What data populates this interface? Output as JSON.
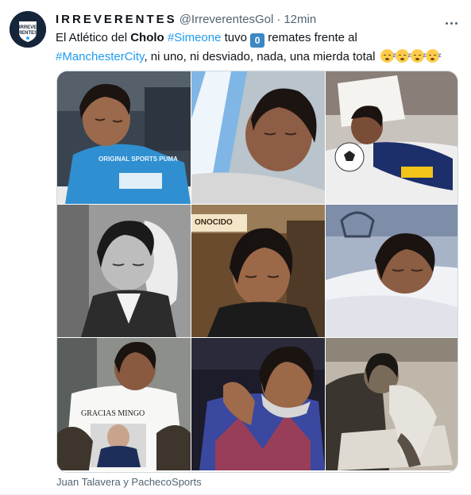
{
  "tweet": {
    "display_name": "IRREVERENTES",
    "handle": "@IrreverentesGol",
    "separator": "·",
    "time": "12min",
    "avatar_text": "IRREVE RENTES",
    "text": {
      "p1": "El Atlético del ",
      "bold1": "Cholo",
      "space1": " ",
      "tag1": "#Simeone",
      "p2": " tuvo ",
      "number": "0",
      "p3": " remates frente al",
      "tag2": "#ManchesterCity",
      "p4": ", ni uno, ni desviado, nada, una mierda total "
    },
    "emoji": [
      "sleeping-face",
      "sleeping-face",
      "sleeping-face",
      "sleeping-face"
    ],
    "media": {
      "count": 9,
      "captions": {
        "shirt_brand": "ORIGINAL SPORTS PUMA",
        "tv_banner": "ONOCIDO",
        "tshirt_text": "GRACIAS MINGO"
      }
    },
    "credit": "Juan Talavera y PachecoSports"
  },
  "colors": {
    "link": "#1d9bf0",
    "secondary": "#536471",
    "text": "#0f1419",
    "badge": "#3b88c3"
  }
}
